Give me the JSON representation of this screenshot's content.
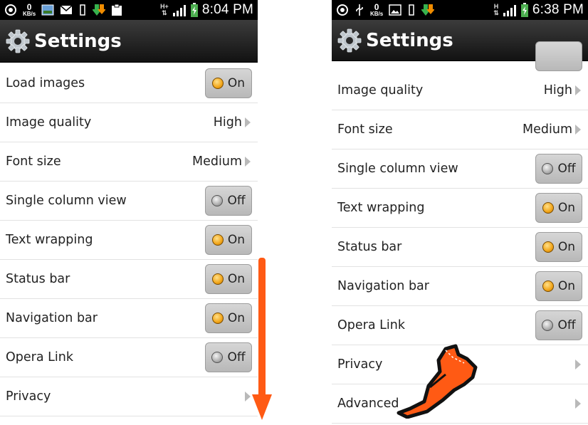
{
  "left": {
    "status": {
      "kbs_value": "0",
      "kbs_unit": "KB/s",
      "network": "H+",
      "time": "8:04 PM"
    },
    "title": "Settings",
    "rows": [
      {
        "label": "Load images",
        "toggle": "On"
      },
      {
        "label": "Image quality",
        "value": "High"
      },
      {
        "label": "Font size",
        "value": "Medium"
      },
      {
        "label": "Single column view",
        "toggle": "Off"
      },
      {
        "label": "Text wrapping",
        "toggle": "On"
      },
      {
        "label": "Status bar",
        "toggle": "On"
      },
      {
        "label": "Navigation bar",
        "toggle": "On"
      },
      {
        "label": "Opera Link",
        "toggle": "Off"
      },
      {
        "label": "Privacy"
      }
    ]
  },
  "right": {
    "status": {
      "kbs_value": "0",
      "kbs_unit": "KB/s",
      "network": "H",
      "time": "6:38 PM"
    },
    "title": "Settings",
    "rows": [
      {
        "label": "Image quality",
        "value": "High"
      },
      {
        "label": "Font size",
        "value": "Medium"
      },
      {
        "label": "Single column view",
        "toggle": "Off"
      },
      {
        "label": "Text wrapping",
        "toggle": "On"
      },
      {
        "label": "Status bar",
        "toggle": "On"
      },
      {
        "label": "Navigation bar",
        "toggle": "On"
      },
      {
        "label": "Opera Link",
        "toggle": "Off"
      },
      {
        "label": "Privacy"
      },
      {
        "label": "Advanced"
      }
    ]
  },
  "colors": {
    "accent_arrow": "#ff5a14",
    "toggle_on_dot": "#f2a61a",
    "toggle_off_dot": "#a8a8a8",
    "title_bar": "#1e1e1e"
  },
  "icons": [
    "settings-gear-icon",
    "scroll-down-arrow-icon",
    "pointing-hand-icon",
    "battery-icon",
    "signal-icon"
  ]
}
